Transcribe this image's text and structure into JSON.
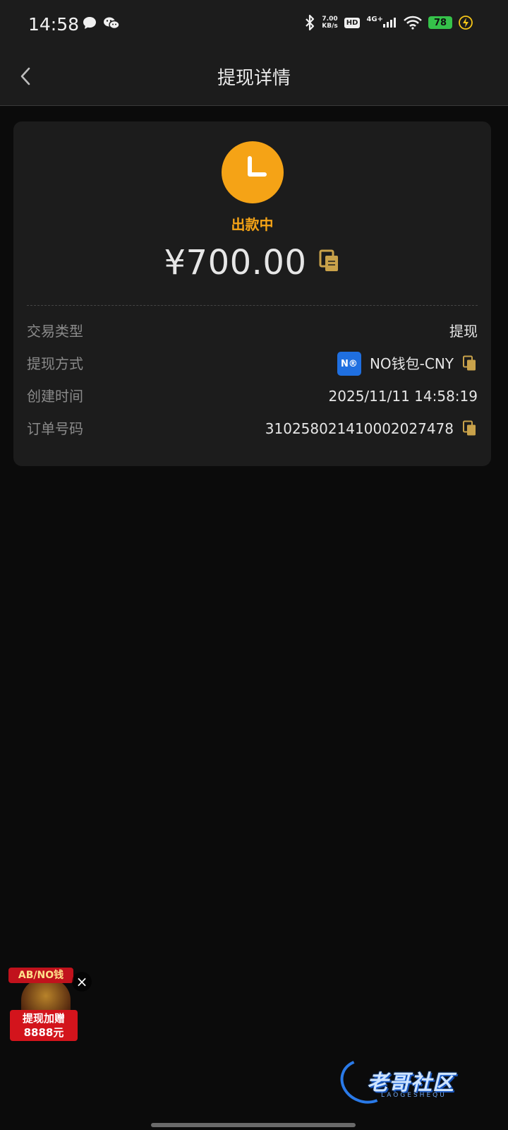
{
  "status_bar": {
    "time": "14:58",
    "net_speed_value": "7.00",
    "net_speed_unit": "KB/s",
    "hd": "HD",
    "net_type": "4G+",
    "battery": "78"
  },
  "header": {
    "title": "提现详情"
  },
  "card": {
    "status_text": "出款中",
    "amount": "¥700.00",
    "rows": [
      {
        "label": "交易类型",
        "value": "提现"
      },
      {
        "label": "提现方式",
        "value": "NO钱包-CNY",
        "logo_text": "N®"
      },
      {
        "label": "创建时间",
        "value": "2025/11/11 14:58:19"
      },
      {
        "label": "订单号码",
        "value": "310258021410002027478"
      }
    ]
  },
  "promo": {
    "top_text": "AB/NO钱",
    "bottom_line1": "提现加赠",
    "bottom_line2": "8888元",
    "close": "×"
  },
  "watermark": {
    "text": "老哥社区",
    "sub": "LAOGESHEQU"
  },
  "colors": {
    "accent": "#f5a316",
    "copy_icon": "#c9a24a",
    "background": "#0b0b0b",
    "card": "#1c1c1c",
    "wallet_logo": "#1f6fe0"
  }
}
